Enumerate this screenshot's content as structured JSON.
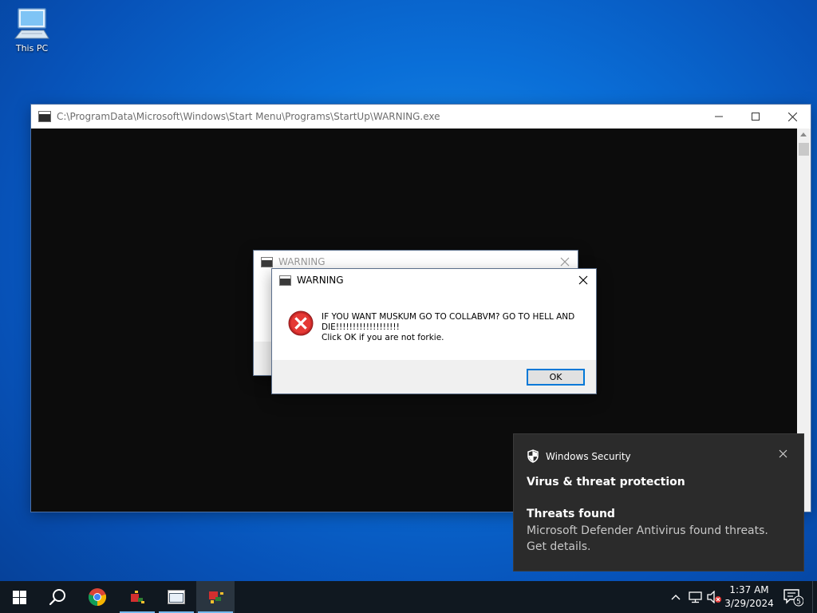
{
  "desktop": {
    "icons": [
      {
        "label": "This PC",
        "icon": "computer-icon"
      }
    ]
  },
  "console_window": {
    "title": "C:\\ProgramData\\Microsoft\\Windows\\Start Menu\\Programs\\StartUp\\WARNING.exe"
  },
  "background_dialog": {
    "title": "WARNING"
  },
  "dialog": {
    "title": "WARNING",
    "icon": "error-icon",
    "message_line1": "IF YOU WANT MUSKUM GO TO COLLABVM? GO TO HELL AND",
    "message_line2": "DIE!!!!!!!!!!!!!!!!!!!",
    "message_line3": "Click OK if you are not forkie.",
    "ok_label": "OK"
  },
  "toast": {
    "app_name": "Windows Security",
    "heading": "Virus & threat protection",
    "subheading": "Threats found",
    "detail": "Microsoft Defender Antivirus found threats. Get details."
  },
  "taskbar": {
    "items": [
      "start-icon",
      "search-icon",
      "chrome-icon",
      "app-icon",
      "console-app-icon",
      "warning-app-icon"
    ],
    "clock": {
      "time": "1:37 AM",
      "date": "3/29/2024"
    },
    "notification_count": "5"
  },
  "colors": {
    "accent": "#0078d7",
    "error_red": "#d32f2f",
    "toast_bg": "#2b2b2b"
  }
}
